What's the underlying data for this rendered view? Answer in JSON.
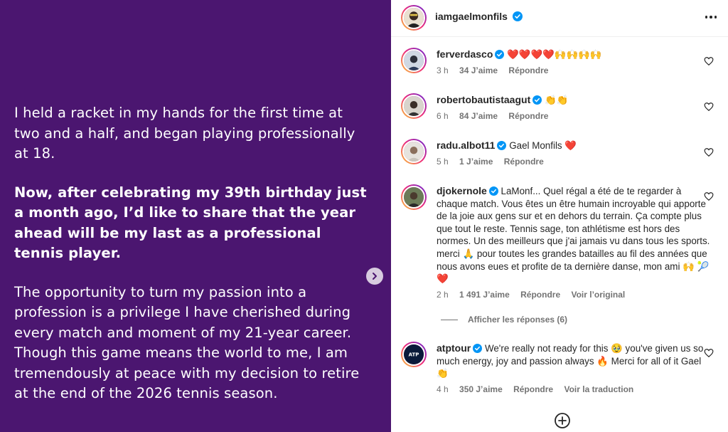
{
  "post": {
    "paragraph1": "I held a racket in my hands for the first time at two and a half, and began playing professionally at 18.",
    "paragraph2": "Now, after celebrating my 39th birthday just a month ago, I’d like to share that the year ahead will be my last as a professional tennis player.",
    "paragraph3": "The opportunity to turn my passion into a profession is a privilege I have cherished during every match and moment of my 21-year career. Though this game means the world to me, I am tremendously at peace with my decision to retire at the end of the 2026 tennis season."
  },
  "header": {
    "username": "iamgaelmonfils"
  },
  "comments": [
    {
      "username": "ferverdasco",
      "text": "❤️❤️❤️❤️🙌🙌🙌🙌",
      "time": "3 h",
      "likes": "34 J’aime",
      "reply": "Répondre"
    },
    {
      "username": "robertobautistaagut",
      "text": "👏👏",
      "time": "6 h",
      "likes": "84 J’aime",
      "reply": "Répondre"
    },
    {
      "username": "radu.albot11",
      "text": "Gael Monfils ❤️",
      "time": "5 h",
      "likes": "1 J’aime",
      "reply": "Répondre"
    },
    {
      "username": "djokernole",
      "text": "LaMonf... Quel régal a été de te regarder à chaque match. Vous êtes un être humain incroyable qui apporte de la joie aux gens sur et en dehors du terrain. Ça compte plus que tout le reste. Tennis sage, ton athlétisme est hors des normes. Un des meilleurs que j'ai jamais vu dans tous les sports. merci 🙏 pour toutes les grandes batailles au fil des années que nous avons eues et profite de ta dernière danse, mon ami 🙌 🎾❤️",
      "time": "2 h",
      "likes": "1 491 J’aime",
      "reply": "Répondre",
      "extra": "Voir l’original"
    },
    {
      "username": "atptour",
      "text": "We're really not ready for this 🥹 you've given us so much energy, joy and passion always 🔥 Merci for all of it Gael 👏",
      "time": "4 h",
      "likes": "350 J’aime",
      "reply": "Répondre",
      "extra": "Voir la traduction"
    }
  ],
  "replies_toggle": "Afficher les réponses (6)",
  "colors": {
    "post_bg": "#4b1670",
    "verified": "#0095f6",
    "muted": "#737373"
  }
}
